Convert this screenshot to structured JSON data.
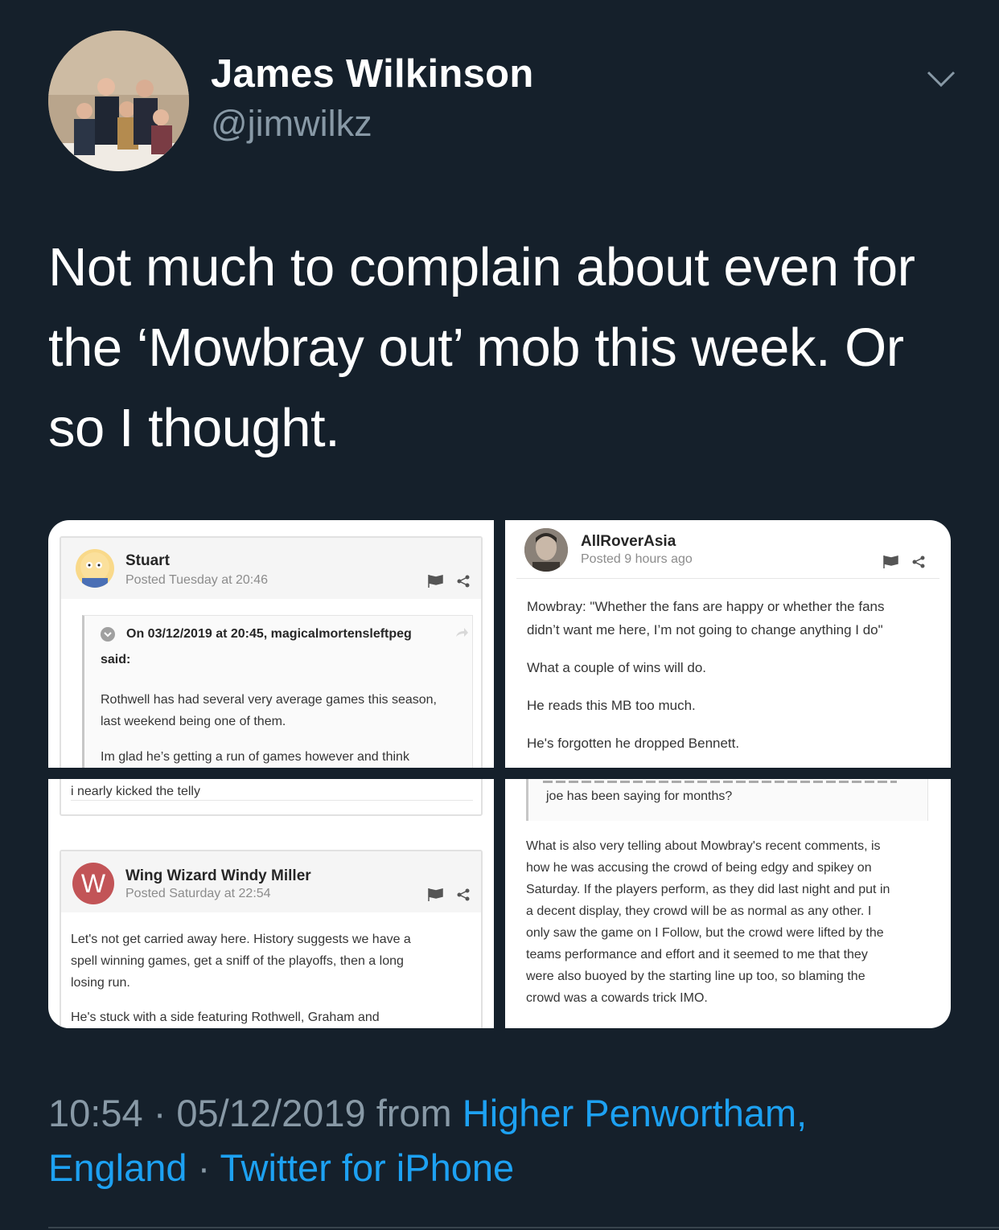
{
  "tweet": {
    "author": {
      "name": "James Wilkinson",
      "handle": "@jimwilkz"
    },
    "text": "Not much to complain about even for the ‘Mowbray out’ mob this week. Or so I thought.",
    "time": "10:54",
    "date": "05/12/2019",
    "from_word": "from",
    "location_line1": "Higher Penwortham,",
    "location_line2": "England",
    "source": "Twitter for iPhone",
    "sep": "·"
  },
  "media": {
    "top_left": {
      "user": "Stuart",
      "posted": "Posted Tuesday at 20:46",
      "quote_header": "On 03/12/2019 at 20:45, magicalmortensleftpeg",
      "quote_said": "said:",
      "lines": [
        "Rothwell has had several very average games this season,",
        "last weekend being one of them.",
        "Im glad he’s getting a run of games however and think"
      ]
    },
    "top_right": {
      "user": "AllRoverAsia",
      "posted": "Posted 9 hours ago",
      "lines": [
        "Mowbray: \"Whether the fans are happy or whether the fans",
        "didn’t want me here, I’m not going to change anything I do\"",
        "What a couple of wins will do.",
        "He reads this MB too much.",
        "He's forgotten he dropped Bennett."
      ]
    },
    "bottom_left": {
      "top_line": "i nearly kicked the telly",
      "user": "Wing Wizard Windy Miller",
      "avatar_letter": "W",
      "posted": "Posted Saturday at 22:54",
      "lines": [
        "Let's not get carried away here.  History suggests we have a",
        "spell winning games, get a sniff of the playoffs, then a long",
        "losing run.",
        "He's stuck with a side featuring Rothwell, Graham and"
      ]
    },
    "bottom_right": {
      "quote_tail": "joe has been saying for months?",
      "lines": [
        "What is also very telling about Mowbray's recent comments, is",
        "how he was accusing the crowd of being edgy and spikey on",
        "Saturday. If the players perform, as they did last night and put in",
        "a decent display, they crowd will be as normal as any other. I",
        "only saw the game on I Follow, but the crowd were lifted by the",
        "teams performance and effort and it seemed to me that they",
        "were also buoyed by the starting line up too, so blaming the",
        "crowd was a cowards trick IMO."
      ]
    }
  },
  "colors": {
    "background": "#15202b",
    "secondary_text": "#8899a6",
    "link": "#1da1f2",
    "quote_avatar": "#c25457"
  },
  "icons": [
    "chevron-down-icon",
    "flag-icon",
    "share-icon",
    "reply-arrow-icon"
  ]
}
